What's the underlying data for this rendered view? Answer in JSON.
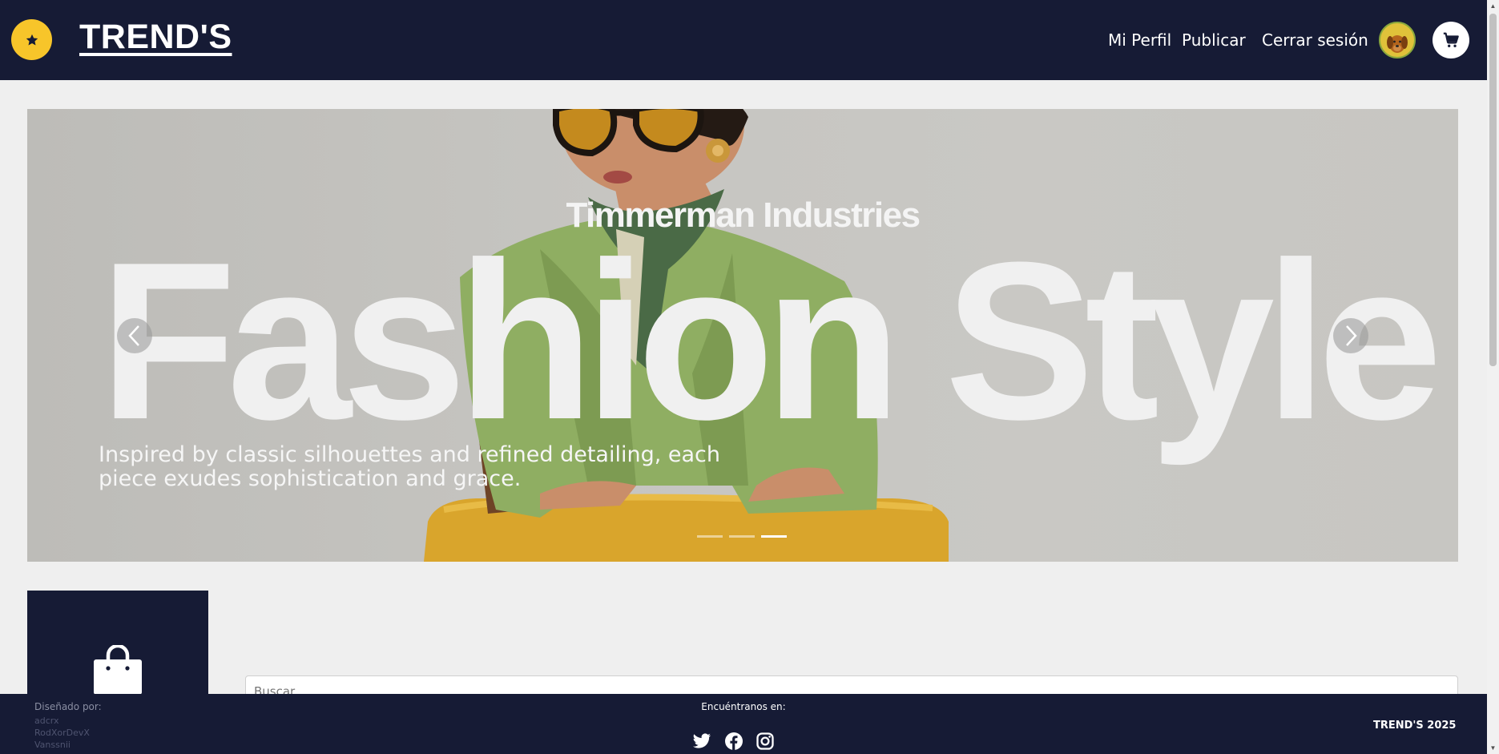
{
  "header": {
    "brand": "TREND'S",
    "nav": {
      "profile": "Mi Perfil",
      "publish": "Publicar",
      "logout": "Cerrar sesión"
    },
    "logo_icon": "star-icon",
    "avatar_icon": "dog-avatar",
    "cart_icon": "cart-icon"
  },
  "carousel": {
    "brand": "Timmerman Industries",
    "title": "Fashion Style",
    "caption": "Inspired by classic silhouettes and refined detailing, each piece exudes sophistication and grace.",
    "slides_count": 3,
    "active_slide": 3,
    "prev_icon": "chevron-left-icon",
    "next_icon": "chevron-right-icon"
  },
  "shop": {
    "icon": "shopping-bag-icon"
  },
  "search": {
    "placeholder": "Buscar..."
  },
  "footer": {
    "designed_by": "Diseñado por:",
    "designers": [
      "adcrx",
      "RodXorDevX",
      "Vanssnii"
    ],
    "find_us": "Encuéntranos en:",
    "social": [
      "twitter-icon",
      "facebook-icon",
      "instagram-icon"
    ],
    "copyright": "TREND'S 2025"
  },
  "colors": {
    "navy": "#161b35",
    "accent_yellow": "#f7c52a",
    "page_bg": "#efefef"
  }
}
